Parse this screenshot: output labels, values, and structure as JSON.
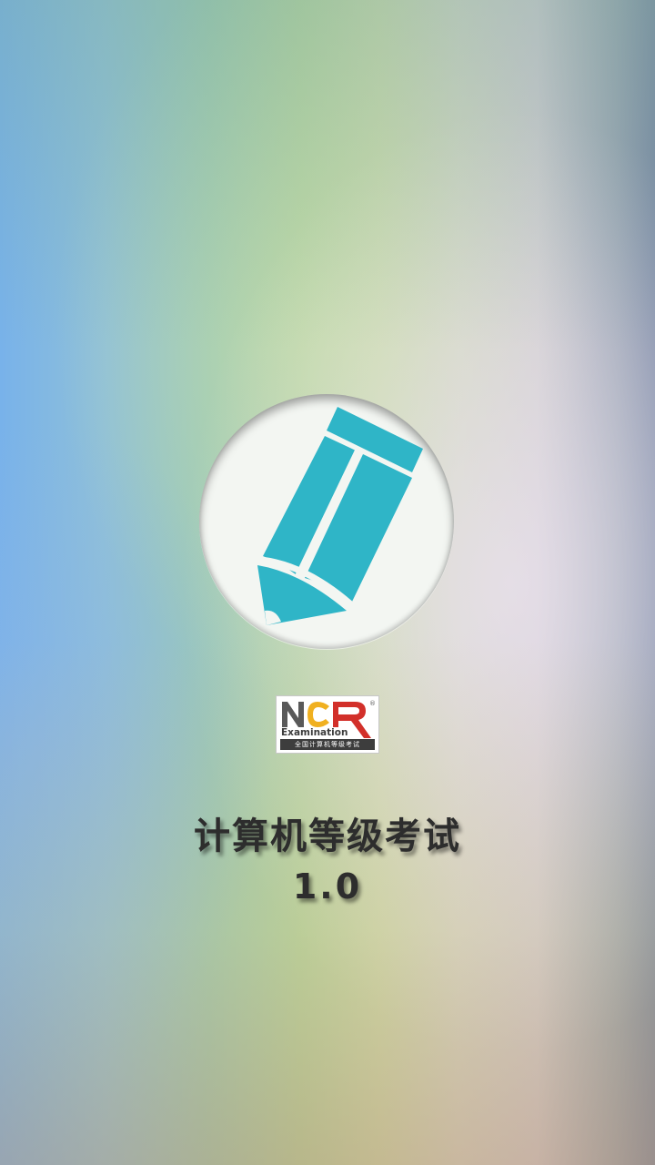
{
  "splash": {
    "title": "计算机等级考试",
    "version": "1.0"
  },
  "app_icon": {
    "icon": "pencil-icon",
    "circle_color": "#f3f6f2",
    "pencil_color": "#2fb5c7"
  },
  "logo": {
    "icon": "ncre-logo",
    "letters": "NCR",
    "registered": "®",
    "word": "Examination",
    "tagline": "全国计算机等级考试",
    "colors": {
      "n": "#595959",
      "c": "#f0b020",
      "r": "#d2302a",
      "text": "#3d3d3d"
    }
  },
  "theme": {
    "text_color": "#2d2d2d"
  }
}
